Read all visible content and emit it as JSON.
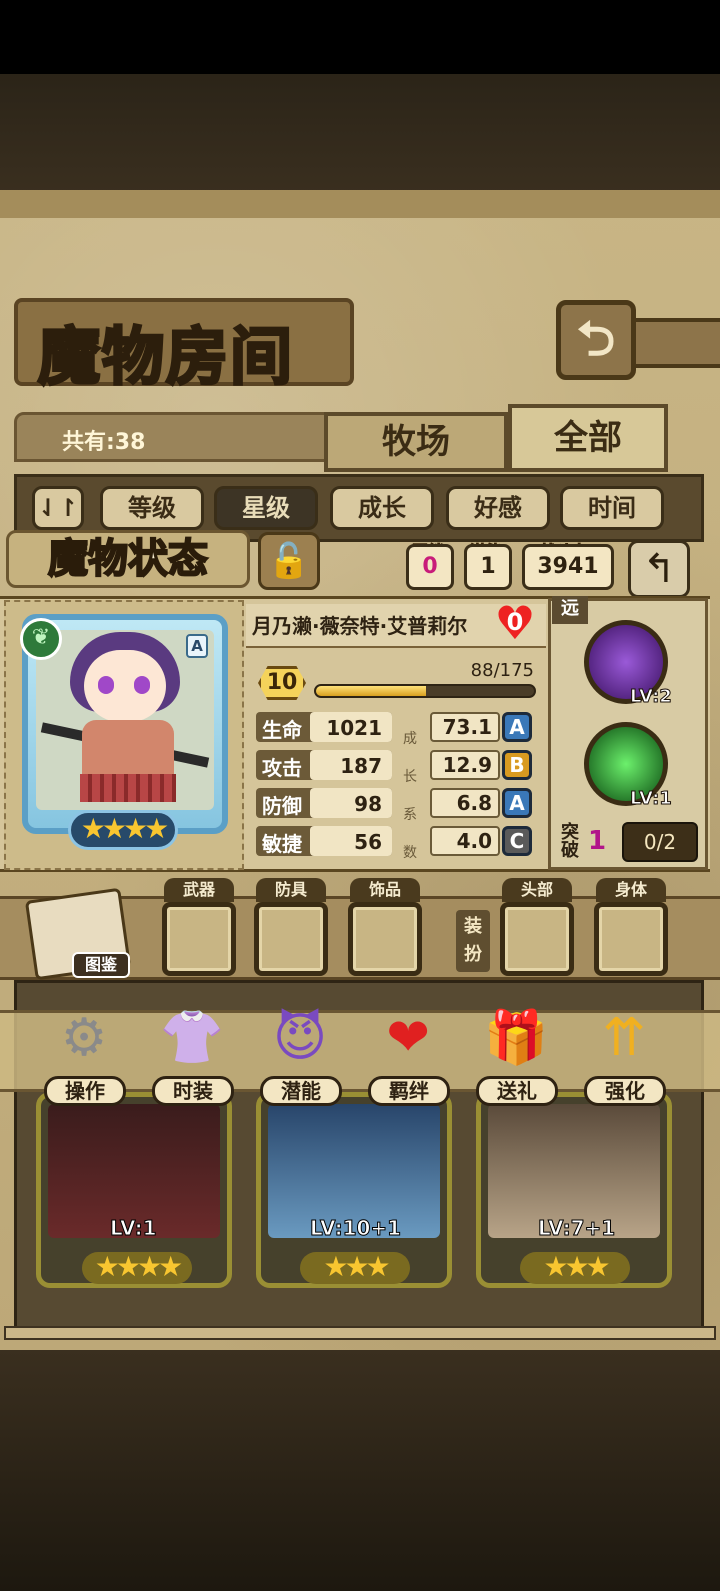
{
  "header": {
    "title": "魔物房间",
    "back_icon": "back-arrow-icon"
  },
  "list": {
    "count_text": "共有:38"
  },
  "tabs": [
    {
      "label": "牧场"
    },
    {
      "label": "全部"
    }
  ],
  "sort": {
    "toggle_icon": "sort-toggle-icon",
    "options": [
      "等级",
      "星级",
      "成长",
      "好感",
      "时间"
    ],
    "active": "星级"
  },
  "status": {
    "title": "魔物状态",
    "bond": {
      "label": "羁绊",
      "value": "0"
    },
    "potential": {
      "label": "潜能",
      "value": "1"
    },
    "power": {
      "label": "战斗力",
      "value": "3941"
    }
  },
  "monster": {
    "name": "月乃濑·薇奈特·艾普莉尔",
    "affection": "0",
    "rank": "A",
    "stars": "★★★★",
    "level": "10",
    "exp_text": "88/175",
    "exp_fraction": 0.503,
    "range": "远",
    "growth_chars": [
      "成",
      "长",
      "系",
      "数"
    ],
    "attributes": [
      {
        "name": "生命",
        "value": "1021",
        "growth": "73.1",
        "grade": "A"
      },
      {
        "name": "攻击",
        "value": "187",
        "growth": "12.9",
        "grade": "B"
      },
      {
        "name": "防御",
        "value": "98",
        "growth": "6.8",
        "grade": "A"
      },
      {
        "name": "敏捷",
        "value": "56",
        "growth": "4.0",
        "grade": "C"
      }
    ],
    "skills": [
      {
        "lv": "LV:2"
      },
      {
        "lv": "LV:1"
      }
    ],
    "breakthrough": {
      "label": "突破",
      "value": "1",
      "progress": "0/2"
    }
  },
  "equipment": {
    "book_label": "图鉴",
    "dress_label": "装扮",
    "slots": [
      {
        "label": "武器"
      },
      {
        "label": "防具"
      },
      {
        "label": "饰品"
      },
      {
        "label": "头部"
      },
      {
        "label": "身体"
      }
    ]
  },
  "actions": [
    {
      "label": "操作",
      "icon": "gear-icon"
    },
    {
      "label": "时装",
      "icon": "outfit-icon"
    },
    {
      "label": "潜能",
      "icon": "demon-icon"
    },
    {
      "label": "羁绊",
      "icon": "hearts-icon"
    },
    {
      "label": "送礼",
      "icon": "gift-icon"
    },
    {
      "label": "强化",
      "icon": "upgrade-arrows-icon"
    }
  ],
  "roster": [
    {
      "lv": "LV:1",
      "stars": "★★★★"
    },
    {
      "lv": "LV:10+1",
      "stars": "★★★"
    },
    {
      "lv": "LV:7+1",
      "stars": "★★★"
    }
  ],
  "colors": {
    "grade_A": "#3a78b8",
    "grade_B": "#d89a20",
    "grade_C": "#5a5a5a",
    "bond_value": "#c81c7a"
  }
}
